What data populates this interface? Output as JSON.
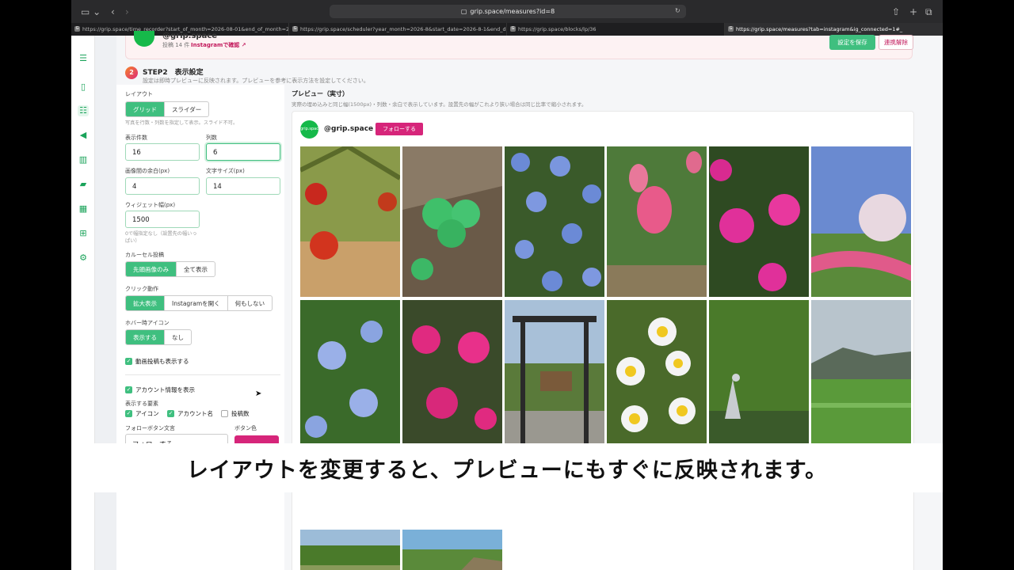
{
  "browser": {
    "url": "grip.space/measures?id=8",
    "tabs": [
      {
        "label": "https://grip.space/time_recorder?start_of_month=2026-08-01&end_of_month=2..."
      },
      {
        "label": "https://grip.space/scheduler?year_month=2026-8&start_date=2026-8-1&end_da..."
      },
      {
        "label": "https://grip.space/blocks/lp/36"
      },
      {
        "label": "https://grip.space/measures?tab=instagram&ig_connected=1#_"
      }
    ]
  },
  "account": {
    "handle": "@grip.space",
    "post_count": "投稿 14 件",
    "ig_confirm": "Instagramで確認 ↗",
    "save_button": "設定を保存",
    "unlink_button": "連携解除"
  },
  "step": {
    "number": "2",
    "title": "STEP2　表示設定",
    "subtitle": "設定は即時プレビューに反映されます。プレビューを参考に表示方法を設定してください。"
  },
  "settings": {
    "layout_label": "レイアウト",
    "layout_options": [
      "グリッド",
      "スライダー"
    ],
    "layout_hint": "写真を行数・列数を指定して表示。スライド不可。",
    "count_label": "表示件数",
    "count_value": "16",
    "columns_label": "列数",
    "columns_value": "6",
    "gap_label": "画像間の余白(px)",
    "gap_value": "4",
    "font_label": "文字サイズ(px)",
    "font_value": "14",
    "width_label": "ウィジェット幅(px)",
    "width_value": "1500",
    "width_hint": "0で幅指定なし（設置先の幅いっぱい）",
    "carousel_label": "カルーセル投稿",
    "carousel_options": [
      "先頭画像のみ",
      "全て表示"
    ],
    "click_label": "クリック動作",
    "click_options": [
      "拡大表示",
      "Instagramを開く",
      "何もしない"
    ],
    "hover_label": "ホバー時アイコン",
    "hover_options": [
      "表示する",
      "なし"
    ],
    "video_label": "動画投稿も表示する",
    "account_info_label": "アカウント情報を表示",
    "elements_label": "表示する要素",
    "elem_icon": "アイコン",
    "elem_name": "アカウント名",
    "elem_posts": "投稿数",
    "follow_text_label": "フォローボタン文言",
    "follow_text_value": "フォローする",
    "button_color_label": "ボタン色"
  },
  "preview": {
    "title": "プレビュー（実寸）",
    "subtitle": "実際の埋め込みと同じ幅(1500px)・列数・余白で表示しています。設置先の幅がこれより狭い場合は同じ比率で縮小されます。",
    "avatar_text": "grip.space",
    "handle": "@grip.space",
    "follow_button": "フォローする"
  },
  "caption": "レイアウトを変更すると、プレビューにもすぐに反映されます。",
  "colors": {
    "accent": "#3fbf7f",
    "brand_pink": "#d6257a"
  }
}
